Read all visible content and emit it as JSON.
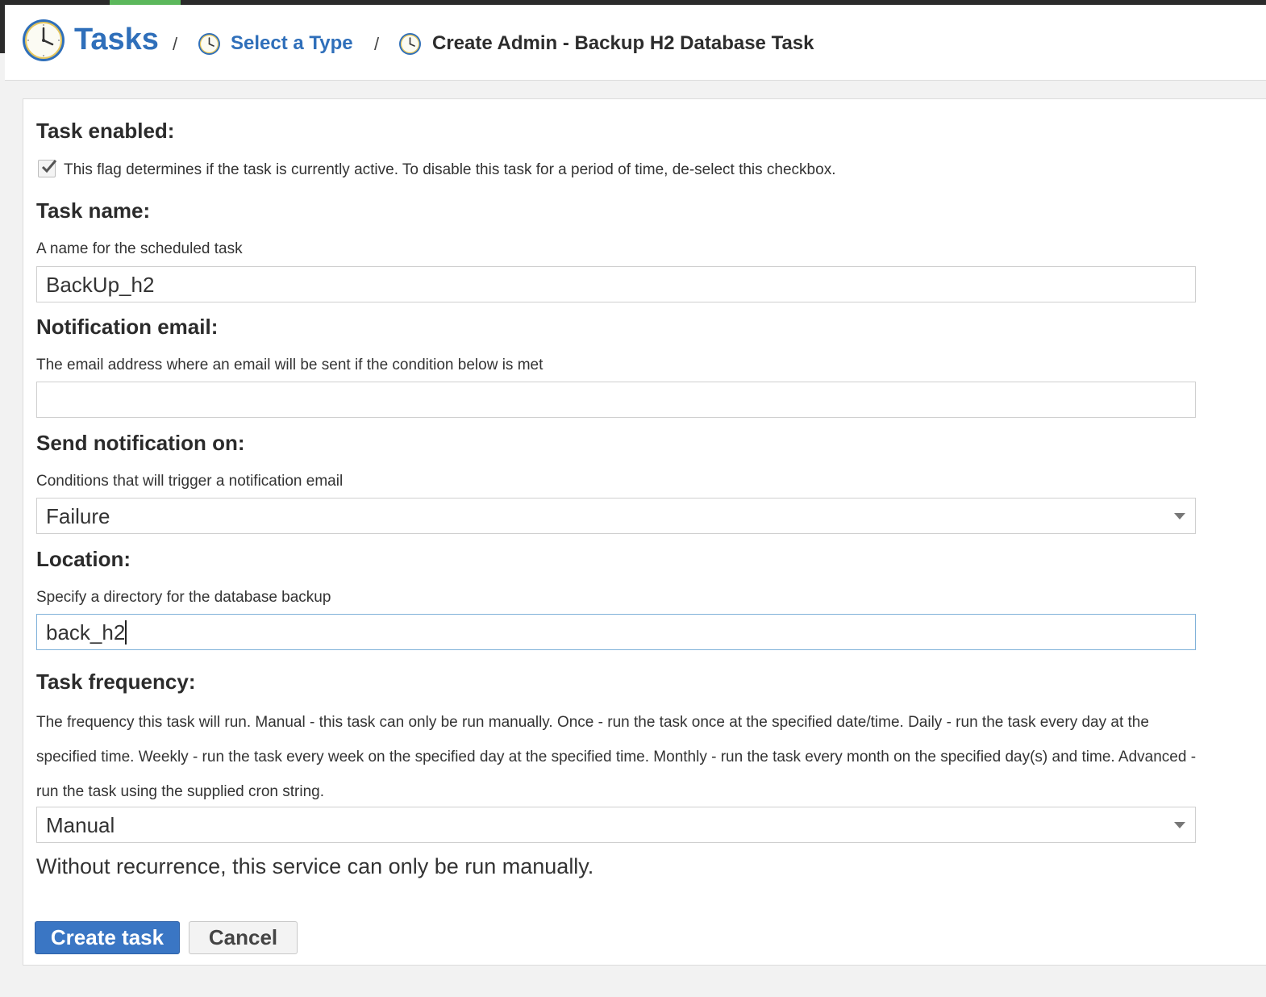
{
  "breadcrumb": {
    "root_label": "Tasks",
    "separator": "/",
    "type_label": "Select a Type",
    "current_label": "Create Admin - Backup H2 Database Task",
    "icon": "clock-icon"
  },
  "form": {
    "enabled": {
      "heading": "Task enabled:",
      "checked": true,
      "description": "This flag determines if the task is currently active. To disable this task for a period of time, de-select this checkbox."
    },
    "name": {
      "heading": "Task name:",
      "description": "A name for the scheduled task",
      "value": "BackUp_h2"
    },
    "email": {
      "heading": "Notification email:",
      "description": "The email address where an email will be sent if the condition below is met",
      "value": ""
    },
    "notify_on": {
      "heading": "Send notification on:",
      "description": "Conditions that will trigger a notification email",
      "selected": "Failure"
    },
    "location": {
      "heading": "Location:",
      "description": "Specify a directory for the database backup",
      "value": "back_h2"
    },
    "frequency": {
      "heading": "Task frequency:",
      "description": "The frequency this task will run. Manual - this task can only be run manually. Once - run the task once at the specified date/time. Daily - run the task every day at the specified time. Weekly - run the task every week on the specified day at the specified time. Monthly - run the task every month on the specified day(s) and time. Advanced - run the task using the supplied cron string.",
      "selected": "Manual",
      "hint": "Without recurrence, this service can only be run manually."
    }
  },
  "buttons": {
    "create_label": "Create task",
    "cancel_label": "Cancel"
  },
  "colors": {
    "accent": "#2f6fba",
    "primary_button": "#3a76c4",
    "top_bar": "#2b2b2b",
    "top_bar_tab": "#5cb85c"
  }
}
